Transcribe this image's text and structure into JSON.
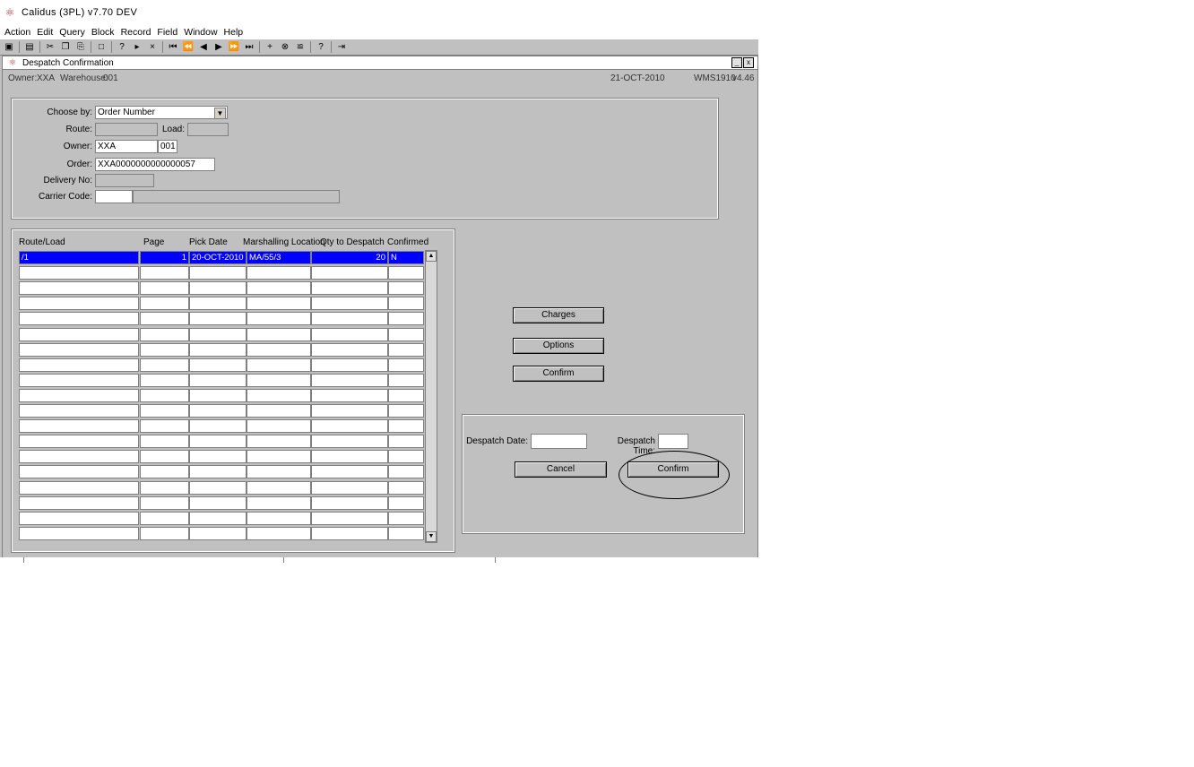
{
  "app": {
    "title": "Calidus (3PL) v7.70 DEV"
  },
  "menu": [
    "Action",
    "Edit",
    "Query",
    "Block",
    "Record",
    "Field",
    "Window",
    "Help"
  ],
  "toolbar_icons": [
    "save-icon",
    "print-icon",
    "cut-icon",
    "copy-icon",
    "paste-icon",
    "clear-icon",
    "enter-query-icon",
    "execute-query-icon",
    "cancel-query-icon",
    "first-record-icon",
    "prev-set-icon",
    "prev-record-icon",
    "next-record-icon",
    "next-set-icon",
    "last-record-icon",
    "insert-record-icon",
    "delete-record-icon",
    "duplicate-icon",
    "help-icon",
    "exit-icon"
  ],
  "window": {
    "title": "Despatch Confirmation",
    "minimize": "_",
    "close": "x"
  },
  "info": {
    "owner_label": "Owner:",
    "owner_value": "XXA",
    "warehouse_label": "Warehouse:",
    "warehouse_value": "001",
    "date": "21-OCT-2010",
    "screen_code": "WMS1910",
    "version": "v4.46"
  },
  "criteria": {
    "choose_by_label": "Choose by:",
    "choose_by_value": "Order Number",
    "route_label": "Route:",
    "route_value": "",
    "load_label": "Load:",
    "load_value": "",
    "owner_label": "Owner:",
    "owner_value": "XXA",
    "owner_sub_value": "001",
    "order_label": "Order:",
    "order_value": "XXA0000000000000057",
    "delivery_label": "Delivery No:",
    "delivery_value": "",
    "carrier_label": "Carrier Code:",
    "carrier_value": "",
    "carrier_desc": ""
  },
  "grid": {
    "headers": [
      "Route/Load",
      "Page",
      "Pick Date",
      "Marshalling Location",
      "Qty to Despatch",
      "Confirmed"
    ],
    "first_row": [
      "/1",
      "1",
      "20-OCT-2010",
      "MA/55/3",
      "20",
      "N"
    ],
    "empty_rows": 18
  },
  "buttons": {
    "charges": "Charges",
    "options": "Options",
    "confirm": "Confirm"
  },
  "dialog": {
    "date_label": "Despatch Date:",
    "date_value": "",
    "time_label": "Despatch Time:",
    "time_value": "",
    "cancel": "Cancel",
    "confirm": "Confirm"
  }
}
